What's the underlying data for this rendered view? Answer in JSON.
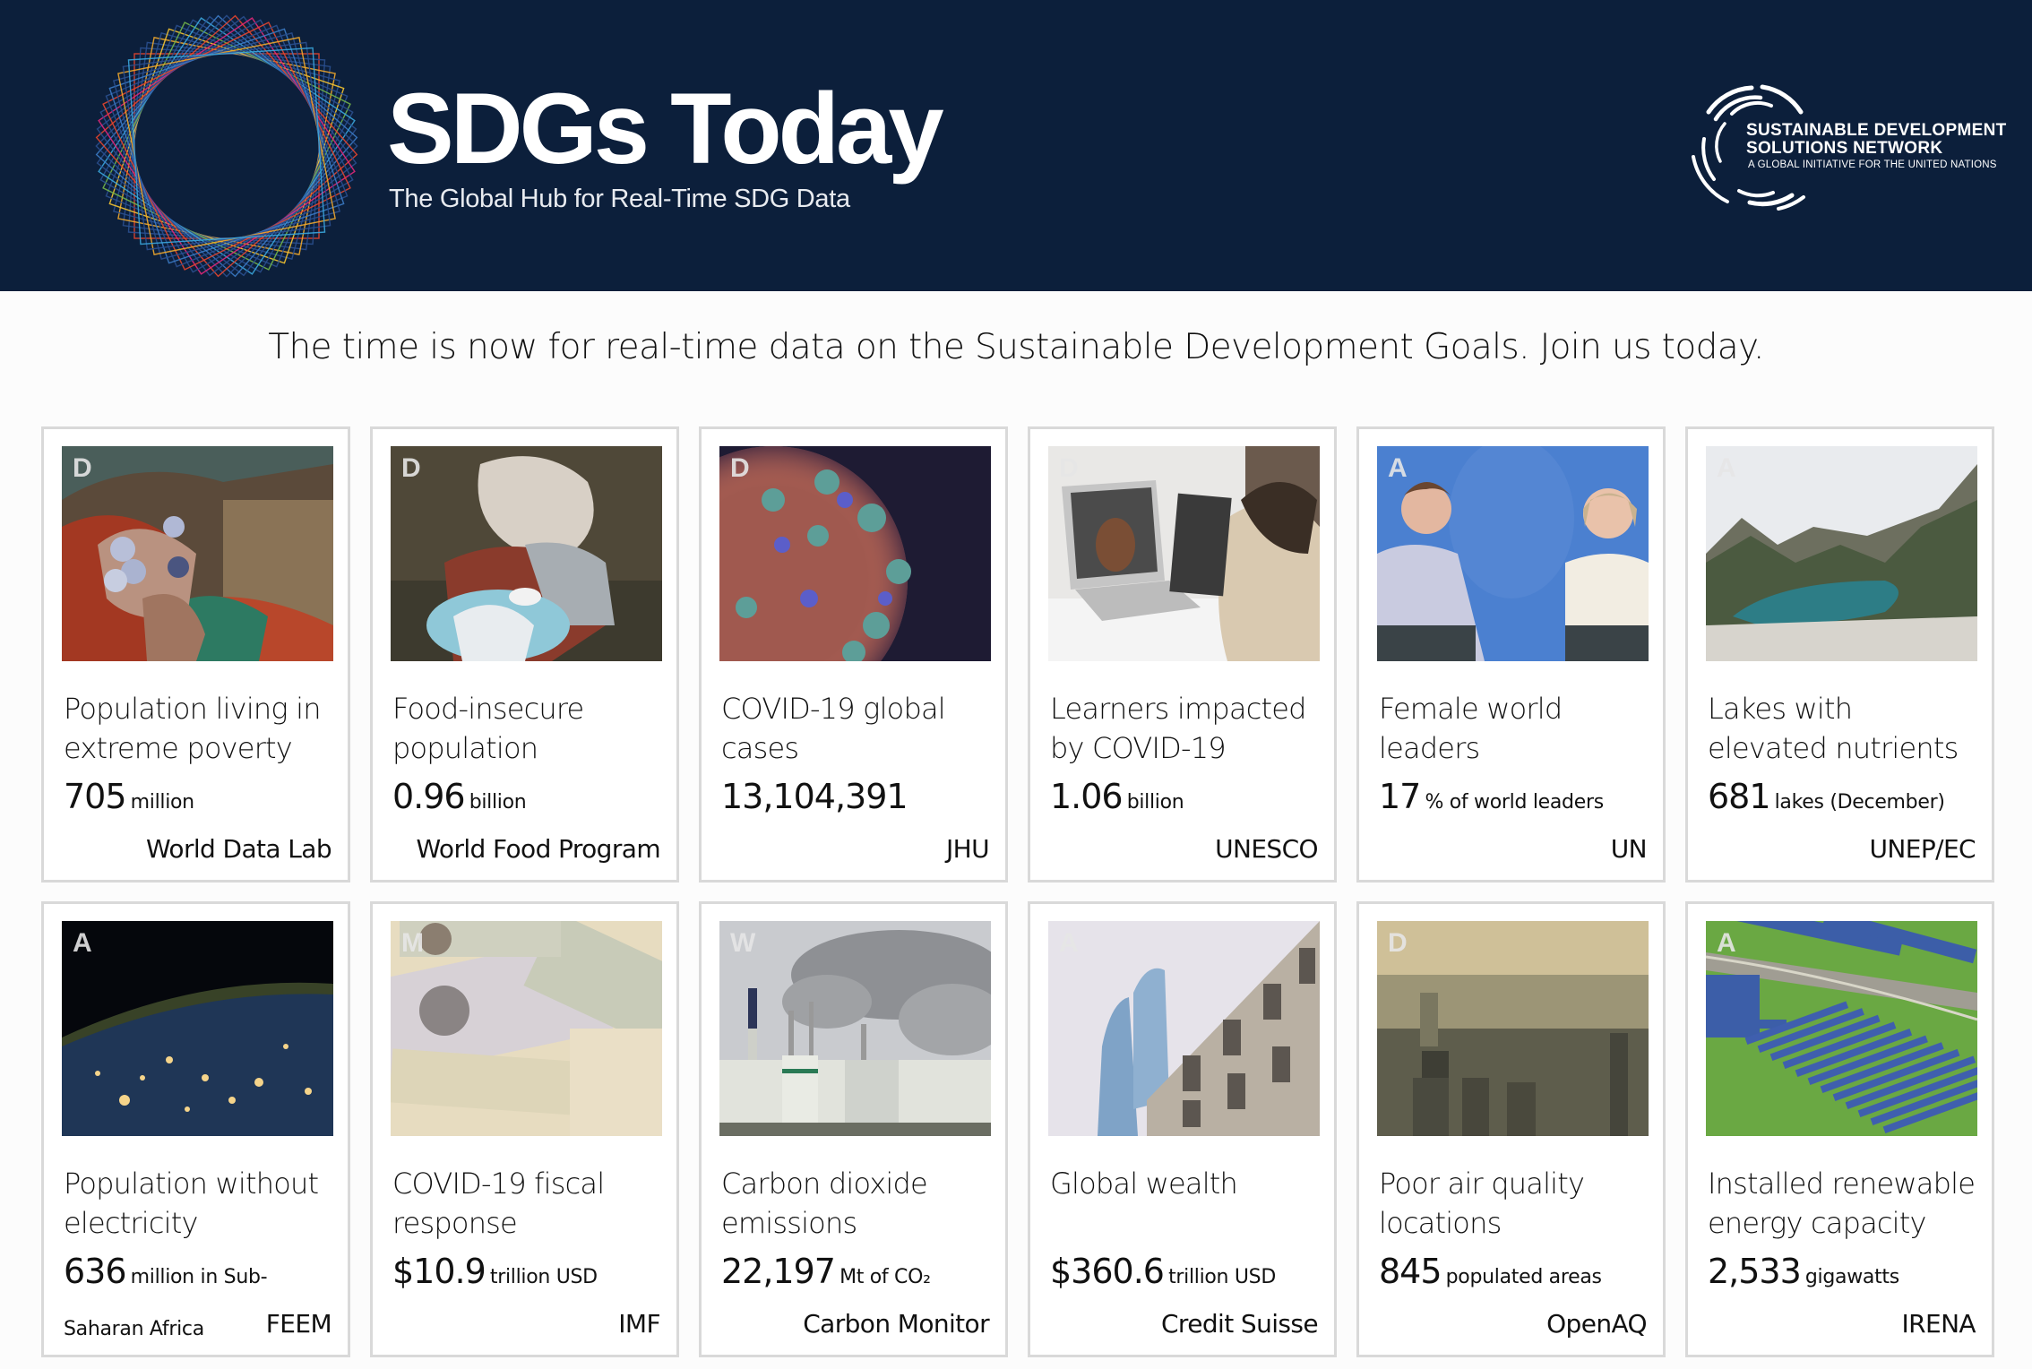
{
  "header": {
    "title": "SDGs Today",
    "subtitle": "The Global Hub for Real-Time SDG Data",
    "partner": {
      "line1": "SUSTAINABLE DEVELOPMENT",
      "line2": "SOLUTIONS NETWORK",
      "line3": "A GLOBAL INITIATIVE FOR THE UNITED NATIONS"
    },
    "colors": {
      "background": "#0c1f3b",
      "text": "#ffffff"
    }
  },
  "tagline": "The time is now for real-time data on the Sustainable Development Goals. Join us today.",
  "cards": [
    {
      "badge": "D",
      "title": "Population living in extreme poverty",
      "value": "705",
      "unit": "million",
      "unit2": "",
      "source": "World Data Lab",
      "image": "hands-with-coins"
    },
    {
      "badge": "D",
      "title": "Food-insecure population",
      "value": "0.96",
      "unit": "billion",
      "unit2": "",
      "source": "World Food Program",
      "image": "person-with-basket"
    },
    {
      "badge": "D",
      "title": "COVID-19 global cases",
      "value": "13,104,391",
      "unit": "",
      "unit2": "",
      "source": "JHU",
      "image": "coronavirus"
    },
    {
      "badge": "D",
      "title": "Learners impacted by COVID-19",
      "value": "1.06",
      "unit": "billion",
      "unit2": "",
      "source": "UNESCO",
      "image": "online-learning"
    },
    {
      "badge": "A",
      "title": "Female world leaders",
      "value": "17",
      "unit": "% of world leaders",
      "unit2": "",
      "source": "UN",
      "image": "female-leaders-podium"
    },
    {
      "badge": "A",
      "title": "Lakes with elevated nutrients",
      "value": "681",
      "unit": "lakes (December)",
      "unit2": "",
      "source": "UNEP/EC",
      "image": "mountain-lake"
    },
    {
      "badge": "A",
      "title": "Population without electricity",
      "value": "636",
      "unit": "million in Sub-",
      "unit2": "Saharan Africa",
      "source": "FEEM",
      "image": "earth-at-night"
    },
    {
      "badge": "M",
      "title": "COVID-19 fiscal response",
      "value": "$10.9",
      "unit": "trillion USD",
      "unit2": "",
      "source": "IMF",
      "image": "dollar-bills"
    },
    {
      "badge": "W",
      "title": "Carbon dioxide emissions",
      "value": "22,197",
      "unit": "Mt of CO₂",
      "unit2": "",
      "source": "Carbon Monitor",
      "image": "power-plant-smoke"
    },
    {
      "badge": "A",
      "title": "Global wealth",
      "value": "$360.6",
      "unit": "trillion USD",
      "unit2": "",
      "source": "Credit Suisse",
      "image": "city-buildings"
    },
    {
      "badge": "D",
      "title": "Poor air quality locations",
      "value": "845",
      "unit": "populated areas",
      "unit2": "",
      "source": "OpenAQ",
      "image": "smoggy-city"
    },
    {
      "badge": "A",
      "title": "Installed renewable energy capacity",
      "value": "2,533",
      "unit": "gigawatts",
      "unit2": "",
      "source": "IRENA",
      "image": "solar-farm"
    }
  ]
}
